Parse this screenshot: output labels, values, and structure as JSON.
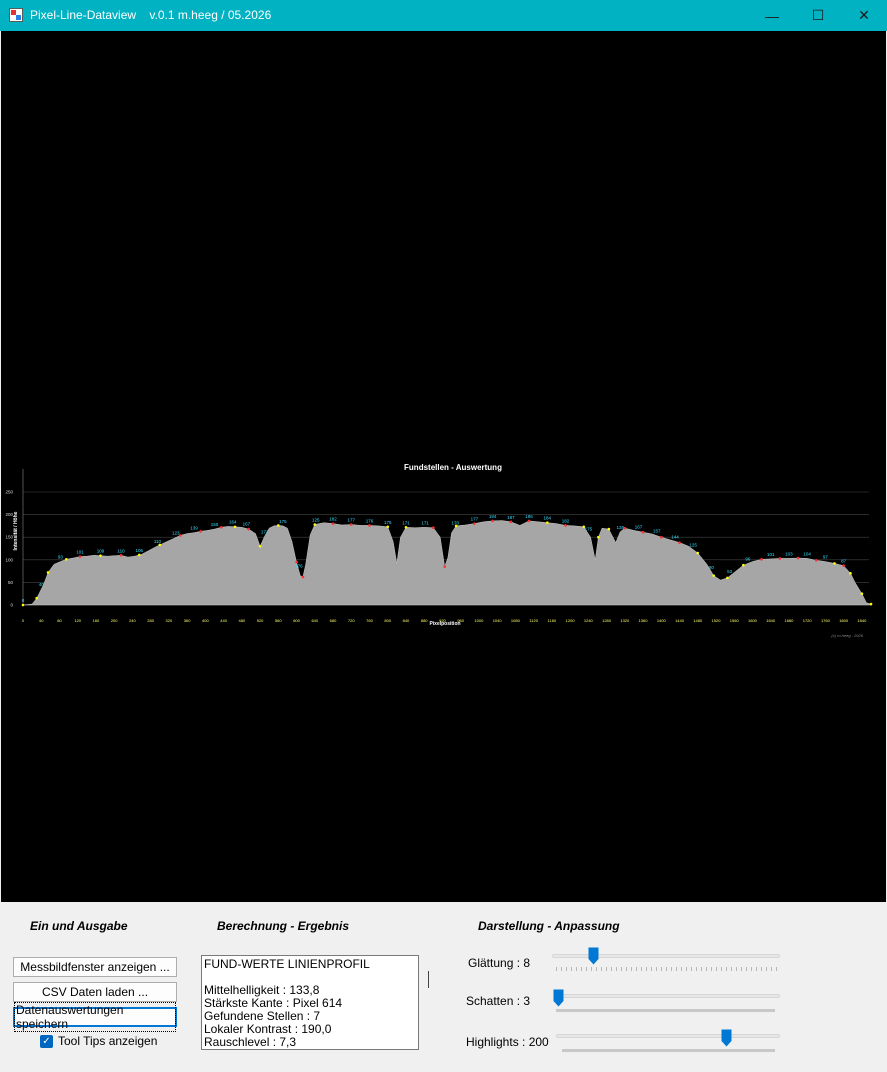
{
  "window": {
    "title": "Pixel-Line-Dataview    v.0.1 m.heeg / 05.2026",
    "minimize_label": "—",
    "maximize_label": "☐",
    "close_label": "✕",
    "accent": "#00b2c2"
  },
  "chart_data": {
    "type": "area",
    "title": "Fundstellen - Auswertung",
    "xlabel": "Pixelposition",
    "ylabel": "Intensität / Höhe",
    "ylim": [
      0,
      250
    ],
    "xlim": [
      0,
      1860
    ],
    "yticks": [
      0,
      50,
      100,
      150,
      200,
      250
    ],
    "xticks": [
      0,
      40,
      80,
      120,
      160,
      200,
      240,
      280,
      320,
      360,
      400,
      440,
      480,
      520,
      560,
      600,
      640,
      680,
      720,
      760,
      800,
      840,
      880,
      920,
      960,
      1000,
      1040,
      1080,
      1120,
      1160,
      1200,
      1240,
      1280,
      1320,
      1360,
      1400,
      1440,
      1480,
      1520,
      1560,
      1600,
      1640,
      1680,
      1720,
      1760,
      1800,
      1840
    ],
    "copyright": "(c) m.heeg - 2026",
    "fill_color": "#a6a6a6",
    "x": [
      0,
      20,
      30,
      45,
      55,
      68,
      82,
      95,
      110,
      125,
      140,
      155,
      170,
      185,
      200,
      215,
      230,
      245,
      260,
      275,
      290,
      300,
      315,
      330,
      345,
      360,
      375,
      390,
      405,
      420,
      435,
      450,
      465,
      480,
      495,
      510,
      520,
      530,
      540,
      550,
      560,
      570,
      580,
      590,
      600,
      608,
      614,
      620,
      630,
      640,
      660,
      680,
      700,
      720,
      740,
      760,
      780,
      800,
      812,
      820,
      828,
      840,
      860,
      880,
      900,
      915,
      925,
      932,
      940,
      950,
      970,
      990,
      1010,
      1030,
      1050,
      1070,
      1090,
      1110,
      1130,
      1150,
      1170,
      1190,
      1210,
      1230,
      1245,
      1255,
      1262,
      1270,
      1285,
      1300,
      1310,
      1320,
      1340,
      1360,
      1380,
      1400,
      1420,
      1440,
      1460,
      1480,
      1500,
      1515,
      1530,
      1545,
      1560,
      1580,
      1600,
      1620,
      1640,
      1660,
      1680,
      1700,
      1720,
      1740,
      1760,
      1780,
      1800,
      1815,
      1825,
      1840,
      1850,
      1860
    ],
    "values": [
      0,
      2,
      15,
      45,
      72,
      90,
      96,
      101,
      104,
      107,
      108,
      110,
      109,
      108,
      109,
      110,
      106,
      108,
      112,
      120,
      128,
      133,
      140,
      147,
      154,
      158,
      160,
      163,
      165,
      168,
      172,
      174,
      173,
      172,
      168,
      158,
      130,
      152,
      170,
      175,
      176,
      175,
      170,
      140,
      95,
      65,
      62,
      90,
      155,
      178,
      182,
      180,
      177,
      178,
      176,
      176,
      175,
      173,
      140,
      92,
      150,
      172,
      171,
      172,
      171,
      150,
      85,
      105,
      160,
      175,
      177,
      180,
      184,
      186,
      187,
      184,
      176,
      186,
      184,
      182,
      180,
      176,
      175,
      173,
      150,
      100,
      150,
      170,
      168,
      138,
      162,
      170,
      165,
      161,
      157,
      150,
      144,
      138,
      130,
      115,
      90,
      65,
      55,
      60,
      72,
      88,
      96,
      101,
      102,
      103,
      103,
      104,
      103,
      99,
      96,
      92,
      87,
      70,
      50,
      25,
      5,
      2
    ],
    "point_labels": [
      {
        "x": 0,
        "text": "0"
      },
      {
        "x": 40,
        "text": "40"
      },
      {
        "x": 82,
        "text": "93"
      },
      {
        "x": 125,
        "text": "101"
      },
      {
        "x": 170,
        "text": "109"
      },
      {
        "x": 215,
        "text": "110"
      },
      {
        "x": 255,
        "text": "106"
      },
      {
        "x": 295,
        "text": "110"
      },
      {
        "x": 335,
        "text": "123"
      },
      {
        "x": 375,
        "text": "139"
      },
      {
        "x": 420,
        "text": "150"
      },
      {
        "x": 460,
        "text": "164"
      },
      {
        "x": 490,
        "text": "167"
      },
      {
        "x": 530,
        "text": "172"
      },
      {
        "x": 570,
        "text": "175"
      },
      {
        "x": 605,
        "text": "176"
      },
      {
        "x": 642,
        "text": "125"
      },
      {
        "x": 680,
        "text": "182"
      },
      {
        "x": 720,
        "text": "177"
      },
      {
        "x": 760,
        "text": "176"
      },
      {
        "x": 800,
        "text": "175"
      },
      {
        "x": 840,
        "text": "171"
      },
      {
        "x": 882,
        "text": "171"
      },
      {
        "x": 948,
        "text": "170"
      },
      {
        "x": 990,
        "text": "177"
      },
      {
        "x": 1030,
        "text": "184"
      },
      {
        "x": 1070,
        "text": "187"
      },
      {
        "x": 1110,
        "text": "186"
      },
      {
        "x": 1150,
        "text": "184"
      },
      {
        "x": 1190,
        "text": "182"
      },
      {
        "x": 1240,
        "text": "175"
      },
      {
        "x": 1310,
        "text": "138"
      },
      {
        "x": 1350,
        "text": "167"
      },
      {
        "x": 1390,
        "text": "157"
      },
      {
        "x": 1430,
        "text": "144"
      },
      {
        "x": 1470,
        "text": "125"
      },
      {
        "x": 1510,
        "text": "80"
      },
      {
        "x": 1550,
        "text": "53"
      },
      {
        "x": 1590,
        "text": "96"
      },
      {
        "x": 1640,
        "text": "101"
      },
      {
        "x": 1680,
        "text": "103"
      },
      {
        "x": 1720,
        "text": "104"
      },
      {
        "x": 1760,
        "text": "97"
      },
      {
        "x": 1800,
        "text": "87"
      }
    ],
    "markers": [
      {
        "x": 0,
        "color": "#ffff00"
      },
      {
        "x": 30,
        "color": "#ffff00"
      },
      {
        "x": 55,
        "color": "#ffff00"
      },
      {
        "x": 95,
        "color": "#ffff00"
      },
      {
        "x": 125,
        "color": "#ff3030"
      },
      {
        "x": 170,
        "color": "#ffff00"
      },
      {
        "x": 215,
        "color": "#ff3030"
      },
      {
        "x": 255,
        "color": "#ffff00"
      },
      {
        "x": 300,
        "color": "#ffff00"
      },
      {
        "x": 345,
        "color": "#ff3030"
      },
      {
        "x": 390,
        "color": "#ff3030"
      },
      {
        "x": 435,
        "color": "#ff3030"
      },
      {
        "x": 465,
        "color": "#ffff00"
      },
      {
        "x": 495,
        "color": "#ff3030"
      },
      {
        "x": 520,
        "color": "#ffff00"
      },
      {
        "x": 560,
        "color": "#ffff00"
      },
      {
        "x": 600,
        "color": "#ff3030"
      },
      {
        "x": 614,
        "color": "#ff3030"
      },
      {
        "x": 640,
        "color": "#ffff00"
      },
      {
        "x": 680,
        "color": "#ff3030"
      },
      {
        "x": 720,
        "color": "#ff3030"
      },
      {
        "x": 760,
        "color": "#ff3030"
      },
      {
        "x": 800,
        "color": "#ffff00"
      },
      {
        "x": 840,
        "color": "#ffff00"
      },
      {
        "x": 900,
        "color": "#ff3030"
      },
      {
        "x": 925,
        "color": "#ff3030"
      },
      {
        "x": 950,
        "color": "#ffff00"
      },
      {
        "x": 990,
        "color": "#ff3030"
      },
      {
        "x": 1030,
        "color": "#ff3030"
      },
      {
        "x": 1070,
        "color": "#ff3030"
      },
      {
        "x": 1110,
        "color": "#ff3030"
      },
      {
        "x": 1150,
        "color": "#ffff00"
      },
      {
        "x": 1190,
        "color": "#ff3030"
      },
      {
        "x": 1230,
        "color": "#ffff00"
      },
      {
        "x": 1262,
        "color": "#ffff00"
      },
      {
        "x": 1285,
        "color": "#ffff00"
      },
      {
        "x": 1320,
        "color": "#ff3030"
      },
      {
        "x": 1360,
        "color": "#ff3030"
      },
      {
        "x": 1400,
        "color": "#ff3030"
      },
      {
        "x": 1440,
        "color": "#ff3030"
      },
      {
        "x": 1480,
        "color": "#ffff00"
      },
      {
        "x": 1515,
        "color": "#ffff00"
      },
      {
        "x": 1545,
        "color": "#ffff00"
      },
      {
        "x": 1580,
        "color": "#ffff00"
      },
      {
        "x": 1620,
        "color": "#ff3030"
      },
      {
        "x": 1660,
        "color": "#ff3030"
      },
      {
        "x": 1700,
        "color": "#ff3030"
      },
      {
        "x": 1740,
        "color": "#ff3030"
      },
      {
        "x": 1780,
        "color": "#ffff00"
      },
      {
        "x": 1800,
        "color": "#ff3030"
      },
      {
        "x": 1815,
        "color": "#ffff00"
      },
      {
        "x": 1840,
        "color": "#ffff00"
      },
      {
        "x": 1860,
        "color": "#ffff00"
      }
    ]
  },
  "panel": {
    "io": {
      "title": "Ein und Ausgabe",
      "btn_show_window": "Messbildfenster anzeigen ...",
      "btn_load_csv": "CSV Daten laden ...",
      "btn_save": "Datenauswertungen speichern",
      "tooltips_label": "Tool Tips anzeigen",
      "tooltips_checked": true,
      "check_glyph": "✓"
    },
    "calc": {
      "title": "Berechnung - Ergebnis",
      "lines": [
        "FUND-WERTE LINIENPROFIL",
        "",
        "Mittelhelligkeit : 133,8",
        "Stärkste Kante : Pixel 614",
        "Gefundene Stellen : 7",
        "Lokaler Kontrast : 190,0",
        "Rauschlevel : 7,3"
      ]
    },
    "display": {
      "title": "Darstellung - Anpassung",
      "smoothing": {
        "label": "Glättung : 8",
        "fraction": 0.15
      },
      "shadow": {
        "label": "Schatten : 3",
        "fraction": 0.0
      },
      "highlights": {
        "label": "Highlights : 200",
        "fraction": 0.78
      },
      "slider_color": "#0078d4"
    }
  }
}
